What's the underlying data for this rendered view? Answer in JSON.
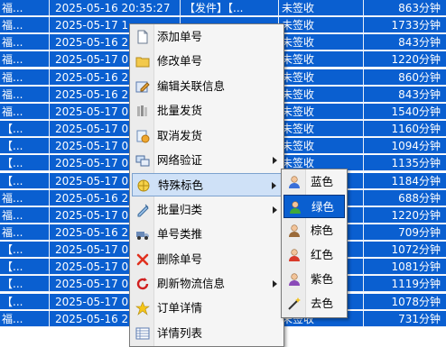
{
  "table": {
    "rows": [
      {
        "c0": "福...",
        "c1": "2025-05-16 20:35:27",
        "c2": "【发件】【...",
        "c3": "未签收",
        "c4": "863分钟"
      },
      {
        "c0": "福...",
        "c1": "2025-05-17 1",
        "c2": "",
        "c3": "未签收",
        "c4": "1733分钟"
      },
      {
        "c0": "福...",
        "c1": "2025-05-16 2",
        "c2": "",
        "c3": "未签收",
        "c4": "843分钟"
      },
      {
        "c0": "福...",
        "c1": "2025-05-17 0",
        "c2": "",
        "c3": "未签收",
        "c4": "1220分钟"
      },
      {
        "c0": "福...",
        "c1": "2025-05-16 2",
        "c2": "",
        "c3": "未签收",
        "c4": "860分钟"
      },
      {
        "c0": "福...",
        "c1": "2025-05-16 2",
        "c2": "",
        "c3": "未签收",
        "c4": "843分钟"
      },
      {
        "c0": "福...",
        "c1": "2025-05-17 0",
        "c2": "",
        "c3": "未签收",
        "c4": "1540分钟"
      },
      {
        "c0": "【...",
        "c1": "2025-05-17 0",
        "c2": "",
        "c3": "未签收",
        "c4": "1160分钟"
      },
      {
        "c0": "【...",
        "c1": "2025-05-17 0",
        "c2": "",
        "c3": "未签收",
        "c4": "1094分钟"
      },
      {
        "c0": "【...",
        "c1": "2025-05-17 0",
        "c2": "",
        "c3": "未签收",
        "c4": "1135分钟"
      },
      {
        "c0": "【...",
        "c1": "2025-05-17 0",
        "c2": "",
        "c3": "",
        "c4": "1184分钟"
      },
      {
        "c0": "福...",
        "c1": "2025-05-16 2",
        "c2": "",
        "c3": "",
        "c4": "688分钟"
      },
      {
        "c0": "福...",
        "c1": "2025-05-17 0",
        "c2": "",
        "c3": "",
        "c4": "1220分钟"
      },
      {
        "c0": "福...",
        "c1": "2025-05-16 2",
        "c2": "",
        "c3": "",
        "c4": "709分钟"
      },
      {
        "c0": "【...",
        "c1": "2025-05-17 0",
        "c2": "",
        "c3": "",
        "c4": "1072分钟"
      },
      {
        "c0": "【...",
        "c1": "2025-05-17 0",
        "c2": "",
        "c3": "",
        "c4": "1081分钟"
      },
      {
        "c0": "【...",
        "c1": "2025-05-17 0",
        "c2": "",
        "c3": "未签收",
        "c4": "1119分钟"
      },
      {
        "c0": "【...",
        "c1": "2025-05-17 0",
        "c2": "",
        "c3": "未签收",
        "c4": "1078分钟"
      },
      {
        "c0": "福...",
        "c1": "2025-05-16 2",
        "c2": "",
        "c3": "未签收",
        "c4": "731分钟"
      }
    ]
  },
  "context_menu": {
    "items": [
      {
        "label": "添加单号",
        "icon": "document-icon",
        "submenu": false
      },
      {
        "label": "修改单号",
        "icon": "folder-icon",
        "submenu": false
      },
      {
        "label": "编辑关联信息",
        "icon": "edit-icon",
        "submenu": false
      },
      {
        "label": "批量发货",
        "icon": "batch-ship-icon",
        "submenu": false
      },
      {
        "label": "取消发货",
        "icon": "cancel-ship-icon",
        "submenu": false
      },
      {
        "label": "网络验证",
        "icon": "network-icon",
        "submenu": true
      },
      {
        "label": "特殊标色",
        "icon": "color-mark-icon",
        "submenu": true
      },
      {
        "label": "批量归类",
        "icon": "category-icon",
        "submenu": true
      },
      {
        "label": "单号类推",
        "icon": "truck-icon",
        "submenu": false
      },
      {
        "label": "删除单号",
        "icon": "delete-icon",
        "submenu": false
      },
      {
        "label": "刷新物流信息",
        "icon": "refresh-icon",
        "submenu": true
      },
      {
        "label": "订单详情",
        "icon": "star-icon",
        "submenu": false
      },
      {
        "label": "详情列表",
        "icon": "list-icon",
        "submenu": false
      }
    ],
    "highlighted_index": 6
  },
  "color_submenu": {
    "items": [
      {
        "label": "蓝色",
        "icon": "user-blue-icon",
        "color": "#3a6fd8"
      },
      {
        "label": "绿色",
        "icon": "user-green-icon",
        "color": "#3fa83a"
      },
      {
        "label": "棕色",
        "icon": "user-brown-icon",
        "color": "#9a6a3a"
      },
      {
        "label": "红色",
        "icon": "user-red-icon",
        "color": "#d83a2a"
      },
      {
        "label": "紫色",
        "icon": "user-purple-icon",
        "color": "#8a4ab8"
      },
      {
        "label": "去色",
        "icon": "magic-wand-icon",
        "color": "#333333"
      }
    ],
    "selected_index": 1
  }
}
